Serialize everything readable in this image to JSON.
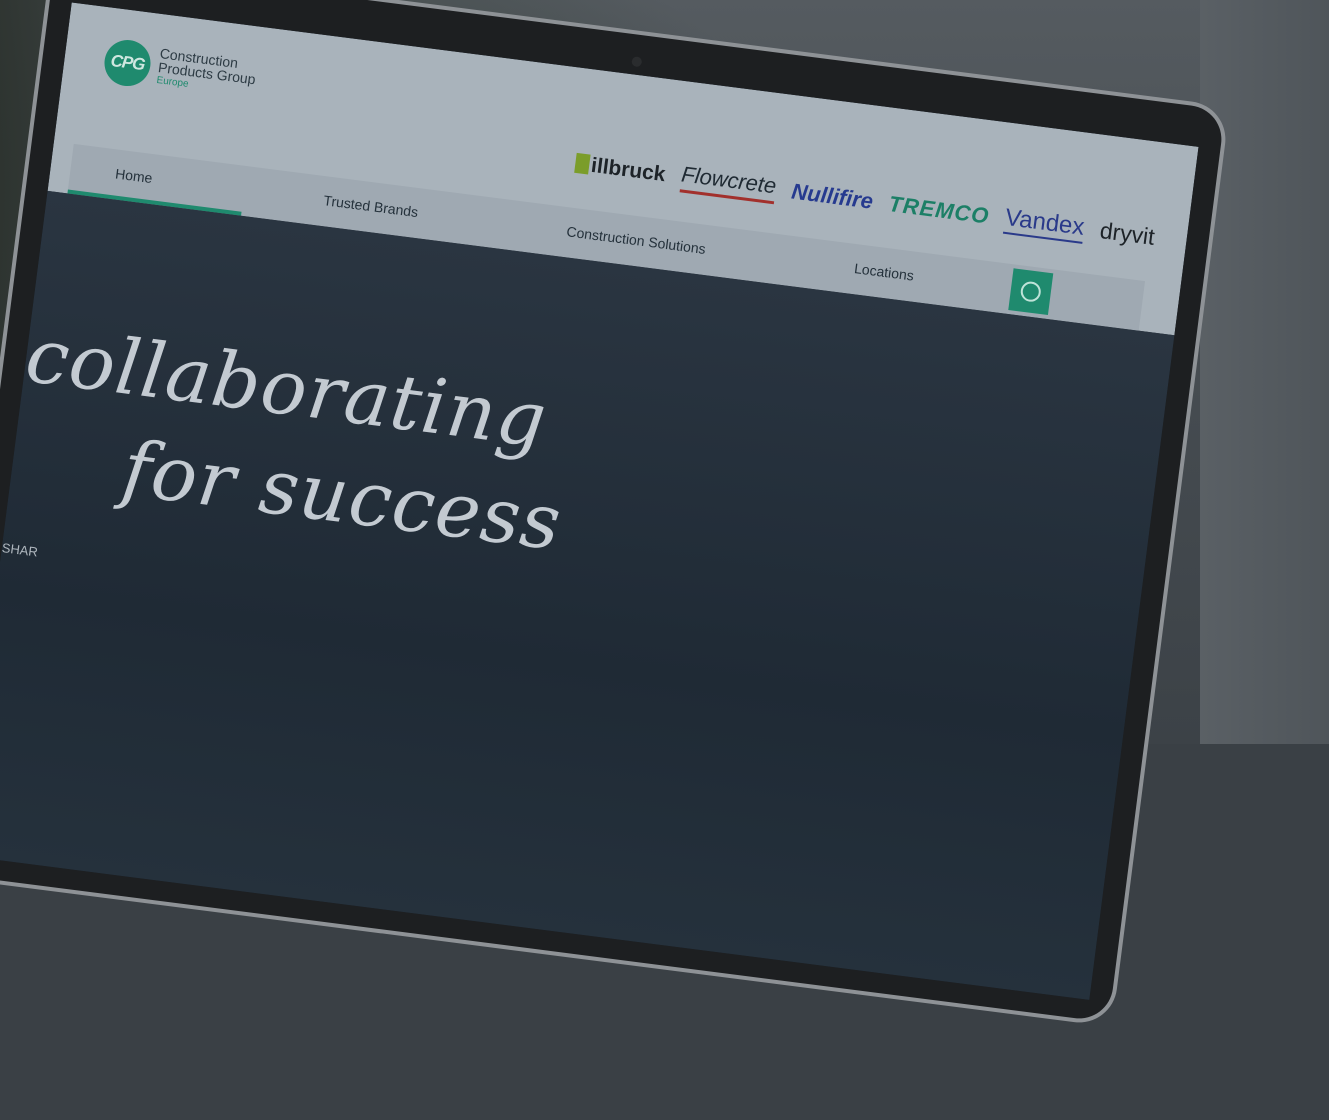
{
  "header": {
    "logo": {
      "mark": "CPG",
      "line1": "Construction",
      "line2": "Products Group",
      "sub": "Europe"
    },
    "brands": [
      "illbruck",
      "Flowcrete",
      "Nullifire",
      "TREMCO",
      "Vandex",
      "dryvit"
    ],
    "accent_color": "#1f8a6e"
  },
  "nav": {
    "items": [
      "Home",
      "Trusted Brands",
      "Construction Solutions",
      "Locations"
    ],
    "active": "Home",
    "search_icon": "globe-icon"
  },
  "hero": {
    "line1": "collaborating",
    "line2": "for success",
    "share_label": "SHAR"
  }
}
